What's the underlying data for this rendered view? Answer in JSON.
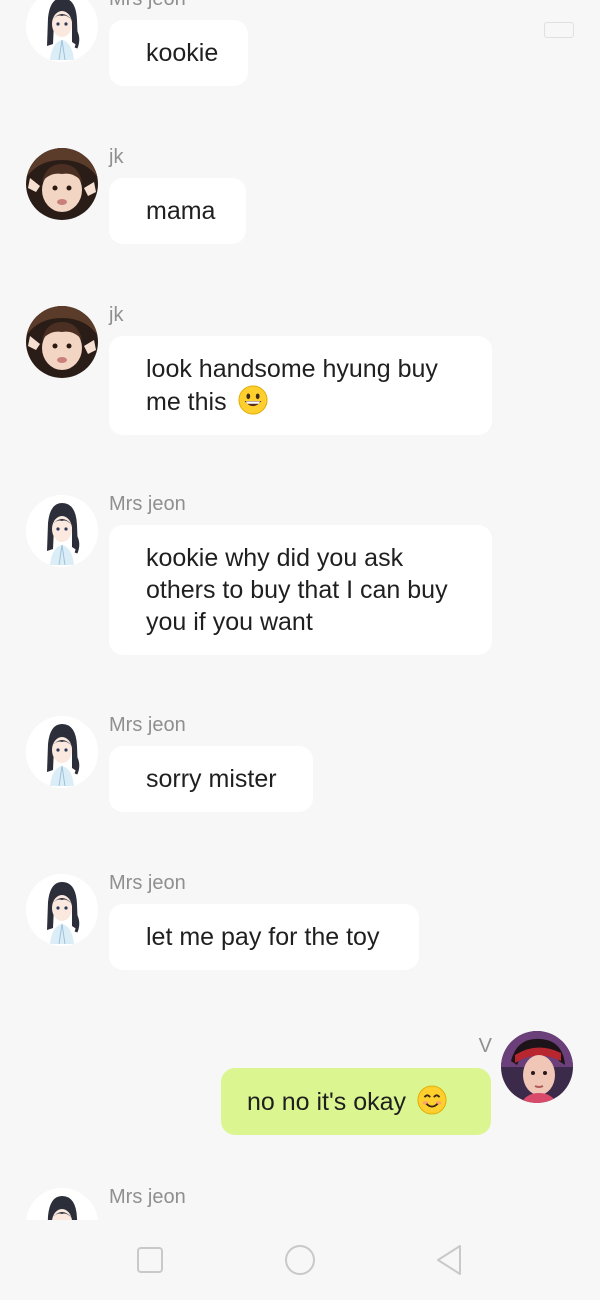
{
  "messages": [
    {
      "side": "left",
      "sender": "Mrs jeon",
      "avatar": "girl-avatar-icon",
      "text": "kookie",
      "emoji": null
    },
    {
      "side": "left",
      "sender": "jk",
      "avatar": "child-photo-avatar",
      "text": "mama",
      "emoji": null
    },
    {
      "side": "left",
      "sender": "jk",
      "avatar": "child-photo-avatar",
      "text": "look handsome hyung buy me this",
      "emoji": "grinning-emoji"
    },
    {
      "side": "left",
      "sender": "Mrs jeon",
      "avatar": "girl-avatar-icon",
      "text": "kookie why did you ask others to buy that I can buy you if you want",
      "emoji": null
    },
    {
      "side": "left",
      "sender": "Mrs jeon",
      "avatar": "girl-avatar-icon",
      "text": "sorry mister",
      "emoji": null
    },
    {
      "side": "left",
      "sender": "Mrs jeon",
      "avatar": "girl-avatar-icon",
      "text": "let me pay for the toy",
      "emoji": null
    },
    {
      "side": "right",
      "sender": "V",
      "avatar": "v-photo-avatar",
      "text": "no no it's okay",
      "emoji": "smiling-emoji"
    },
    {
      "side": "left",
      "sender": "Mrs jeon",
      "avatar": "girl-avatar-icon",
      "text": "",
      "emoji": null
    }
  ],
  "navbar": {
    "icons": [
      "recent-apps-icon",
      "home-icon",
      "back-icon"
    ]
  },
  "colors": {
    "background": "#f7f7f7",
    "bubble_left": "#ffffff",
    "bubble_right": "#dbf690",
    "sender_text": "#8f8f8f",
    "message_text": "#1f1f1f"
  }
}
